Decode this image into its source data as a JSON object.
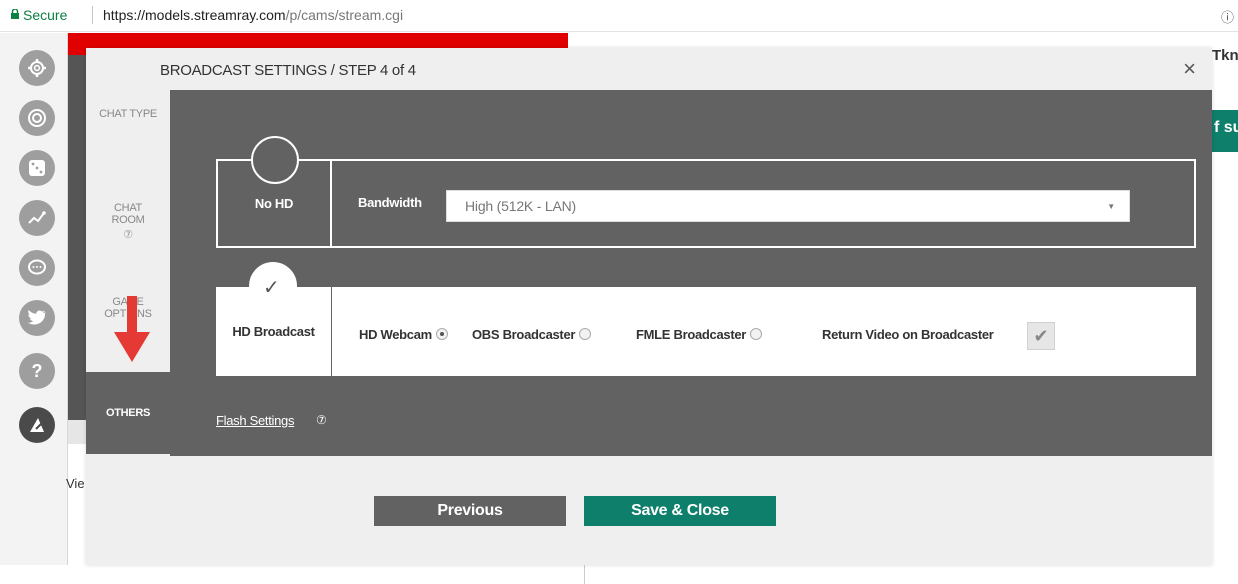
{
  "browser": {
    "secure_label": "Secure",
    "url_scheme_host": "https://models.streamray.com",
    "url_path": "/p/cams/stream.cgi",
    "right_icon": "info-icon"
  },
  "rail": {
    "icons": [
      "gear-icon",
      "target-icon",
      "dice-icon",
      "chart-icon",
      "chat-icon",
      "twitter-icon",
      "help-icon",
      "edit-icon"
    ]
  },
  "background": {
    "left_text": "Vie",
    "right_text_top": "Tkn",
    "right_text_green": "f su"
  },
  "modal": {
    "title": "BROADCAST SETTINGS / STEP 4 of 4",
    "close_label": "×",
    "tabs": [
      {
        "label": "CHAT TYPE"
      },
      {
        "label_line1": "CHAT",
        "label_line2": "ROOM",
        "help": "⑦"
      },
      {
        "label_line1": "GAME",
        "label_line2": "OPTIONS"
      },
      {
        "label": "OTHERS"
      }
    ],
    "no_hd": {
      "label": "No HD",
      "bandwidth_label": "Bandwidth",
      "bandwidth_value": "High (512K - LAN)"
    },
    "hd": {
      "label": "HD Broadcast",
      "option1": "HD Webcam",
      "option2": "OBS Broadcaster",
      "option3": "FMLE Broadcaster",
      "option4": "Return Video on Broadcaster",
      "selected": "HD Webcam",
      "return_video_checked": true
    },
    "flash_settings": "Flash Settings",
    "flash_help": "⑦",
    "buttons": {
      "previous": "Previous",
      "save_close": "Save & Close"
    }
  },
  "colors": {
    "panel": "#626262",
    "accent": "#0d7f6a",
    "arrow": "#e53935"
  }
}
